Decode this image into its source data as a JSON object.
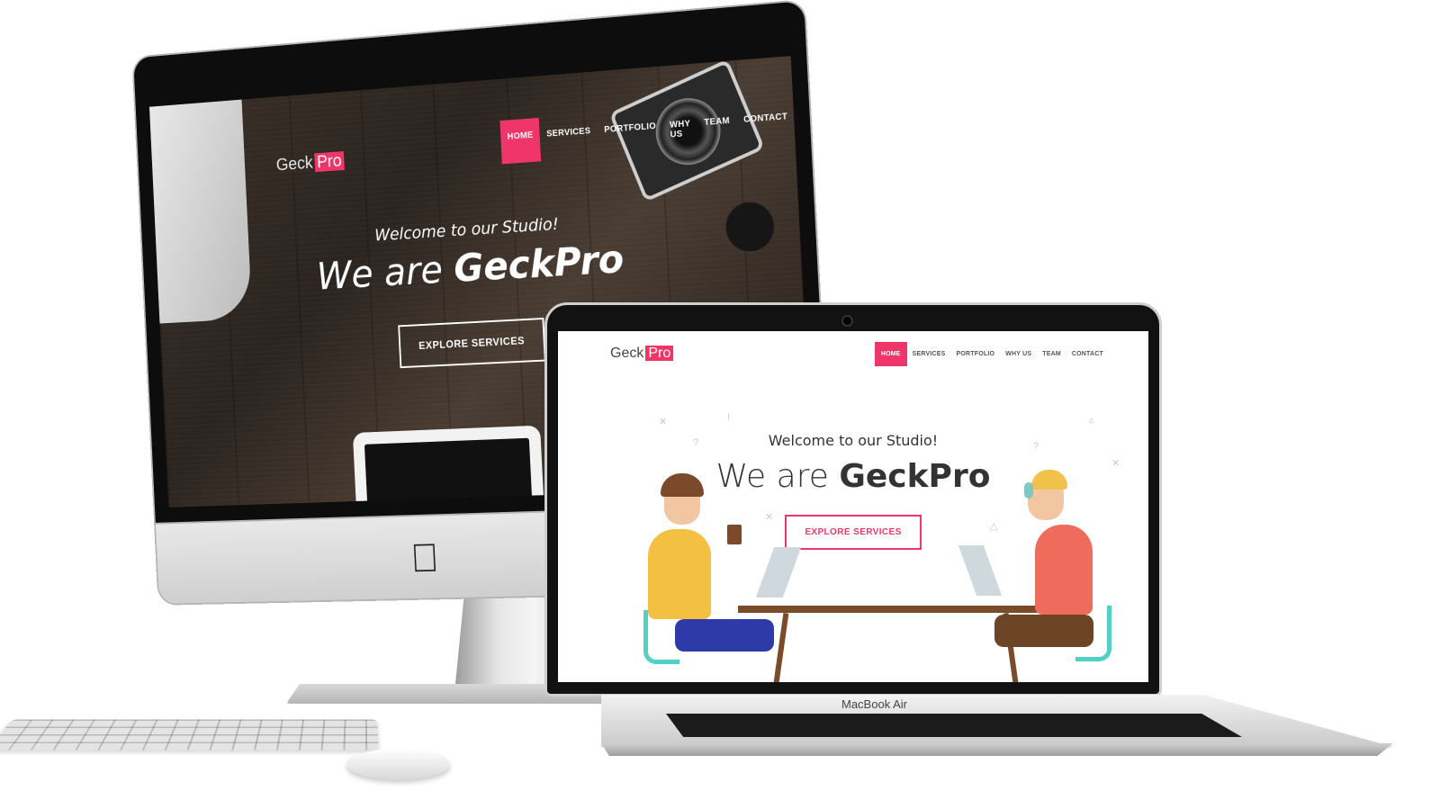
{
  "brand": {
    "name": "Geck",
    "suffix": "Pro",
    "accent": "#f0356a"
  },
  "nav": {
    "items": [
      {
        "label": "HOME",
        "active": true
      },
      {
        "label": "SERVICES",
        "active": false
      },
      {
        "label": "PORTFOLIO",
        "active": false
      },
      {
        "label": "WHY US",
        "active": false
      },
      {
        "label": "TEAM",
        "active": false
      },
      {
        "label": "CONTACT",
        "active": false
      }
    ]
  },
  "hero": {
    "welcome": "Welcome to our Studio!",
    "headline_prefix": "We are",
    "headline_brand": "GeckPro",
    "cta": "EXPLORE SERVICES"
  },
  "device": {
    "laptop_label": "MacBook Air",
    "desktop_logo": "apple-logo-icon"
  }
}
